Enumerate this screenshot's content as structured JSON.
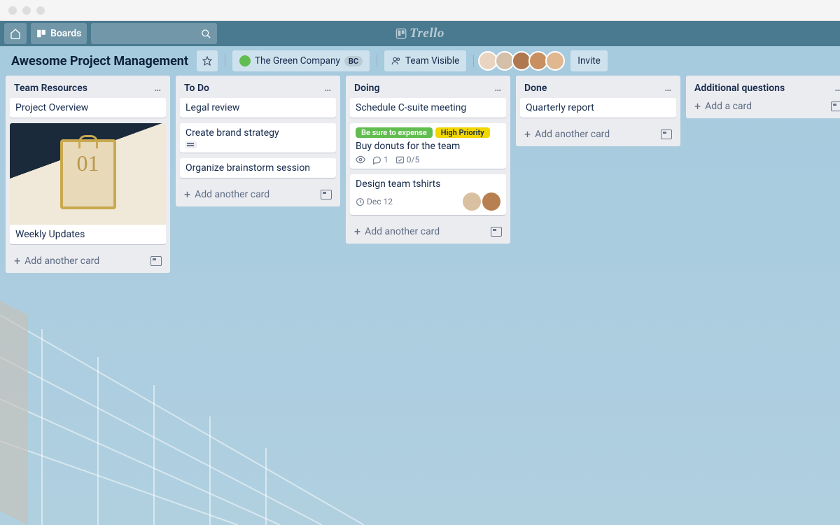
{
  "topbar": {
    "boards_label": "Boards",
    "logo_text": "Trello"
  },
  "board_header": {
    "title": "Awesome Project Management",
    "team_name": "The Green Company",
    "team_badge": "BC",
    "visibility": "Team Visible",
    "invite_label": "Invite",
    "member_count": 5
  },
  "lists": [
    {
      "title": "Team Resources",
      "cards": [
        {
          "title": "Project Overview"
        },
        {
          "title": "Weekly Updates",
          "has_cover": true,
          "cover_text": "01"
        }
      ],
      "add_label": "Add another card"
    },
    {
      "title": "To Do",
      "cards": [
        {
          "title": "Legal review"
        },
        {
          "title": "Create brand strategy",
          "has_description": true
        },
        {
          "title": "Organize brainstorm session"
        }
      ],
      "add_label": "Add another card"
    },
    {
      "title": "Doing",
      "cards": [
        {
          "title": "Schedule C-suite meeting"
        },
        {
          "title": "Buy donuts for the team",
          "labels": [
            {
              "text": "Be sure to expense",
              "color": "green"
            },
            {
              "text": "High Priority",
              "color": "yellow"
            }
          ],
          "badges": {
            "watch": true,
            "comments": "1",
            "checklist": "0/5"
          }
        },
        {
          "title": "Design team tshirts",
          "due": "Dec 12",
          "members": 2
        }
      ],
      "add_label": "Add another card"
    },
    {
      "title": "Done",
      "cards": [
        {
          "title": "Quarterly report"
        }
      ],
      "add_label": "Add another card"
    },
    {
      "title": "Additional questions",
      "cards": [],
      "add_label": "Add a card"
    }
  ]
}
